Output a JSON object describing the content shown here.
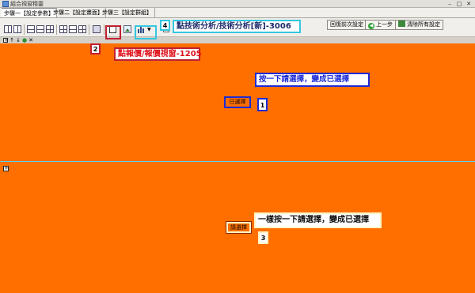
{
  "window": {
    "title": "組合視窗精靈"
  },
  "steps": [
    {
      "label": "步驟一【設定參數】"
    },
    {
      "label": "步驟二【設定畫面】"
    },
    {
      "label": "步驟三【設定群組】"
    }
  ],
  "toolbar": {
    "reset_label": "回復前次設定",
    "prev_label": "上一步",
    "clear_label": "清除所有設定"
  },
  "annotations": {
    "n1": "1",
    "n2": "2",
    "n3": "3",
    "n4": "4",
    "label2": "點報價/報價視窗-1205",
    "label4": "點技術分析/技術分析[新]-3006",
    "label_top": "按一下請選擇，變成已選擇",
    "label_bottom": "一樣按一下請選擇，變成已選擇"
  },
  "panels": {
    "top_button": "已選擇",
    "bottom_button": "請選擇"
  },
  "colors": {
    "panel_bg": "#ff6f00",
    "splitter": "#56d4f0",
    "box_red": "#c0202f",
    "box_cyan": "#35c6e0",
    "box_blue": "#1c2bd6",
    "label_red": "#e0101a"
  }
}
